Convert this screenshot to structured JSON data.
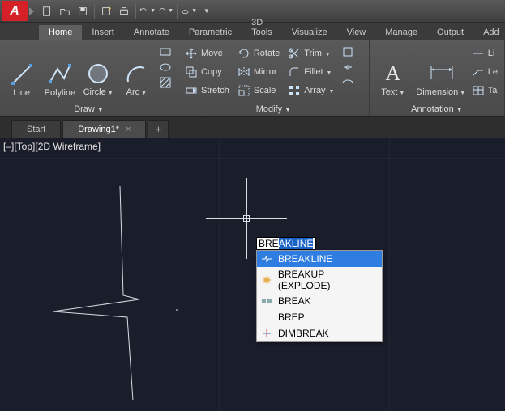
{
  "app": {
    "letter": "A"
  },
  "ribbon_tabs": [
    "Home",
    "Insert",
    "Annotate",
    "Parametric",
    "3D Tools",
    "Visualize",
    "View",
    "Manage",
    "Output",
    "Add"
  ],
  "active_ribbon_tab": 0,
  "panels": {
    "draw": {
      "title": "Draw",
      "buttons": {
        "line": "Line",
        "polyline": "Polyline",
        "circle": "Circle",
        "arc": "Arc"
      }
    },
    "modify": {
      "title": "Modify",
      "items": {
        "move": "Move",
        "copy": "Copy",
        "stretch": "Stretch",
        "rotate": "Rotate",
        "mirror": "Mirror",
        "scale": "Scale",
        "trim": "Trim",
        "fillet": "Fillet",
        "array": "Array"
      }
    },
    "annotation": {
      "title": "Annotation",
      "buttons": {
        "text": "Text",
        "dimension": "Dimension"
      },
      "items": {
        "li": "Li",
        "le": "Le",
        "ta": "Ta"
      }
    }
  },
  "doc_tabs": [
    {
      "label": "Start",
      "active": false,
      "closable": false
    },
    {
      "label": "Drawing1*",
      "active": true,
      "closable": true
    }
  ],
  "view_label": "[–][Top][2D Wireframe]",
  "command": {
    "typed": "BRE",
    "completion": "AKLINE",
    "suggestions": [
      {
        "label": "BREAKLINE",
        "icon": "bl"
      },
      {
        "label": "BREAKUP (EXPLODE)",
        "icon": "expl"
      },
      {
        "label": "BREAK",
        "icon": "brk"
      },
      {
        "label": "BREP",
        "icon": ""
      },
      {
        "label": "DIMBREAK",
        "icon": "dim"
      }
    ],
    "selected": 0
  }
}
